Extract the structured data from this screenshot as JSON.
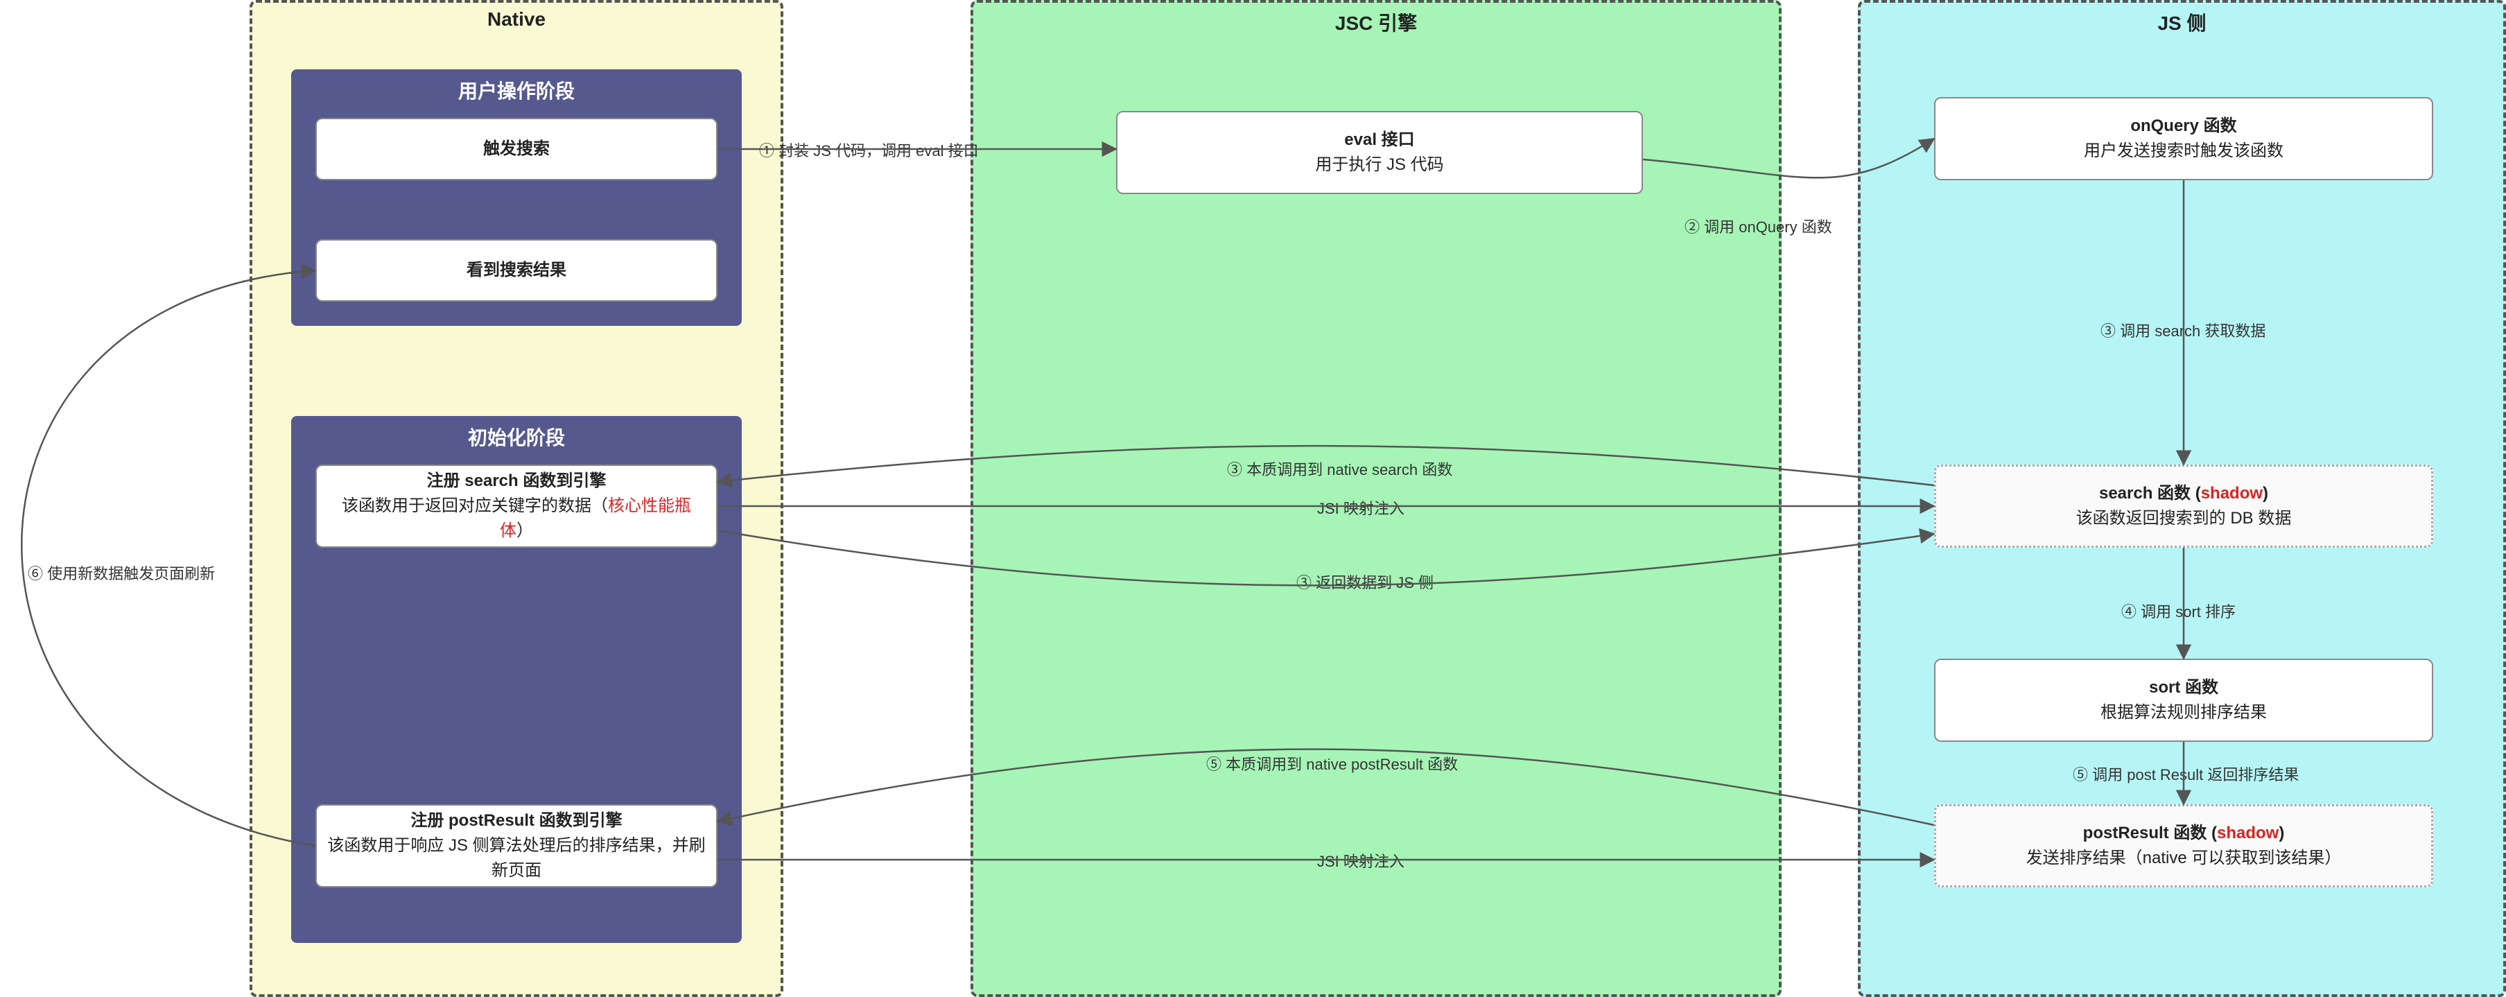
{
  "lanes": {
    "native": "Native",
    "jsc": "JSC 引擎",
    "js": "JS 侧"
  },
  "groups": {
    "user": "用户操作阶段",
    "init": "初始化阶段"
  },
  "nodes": {
    "trigger_search": {
      "t1": "触发搜索"
    },
    "see_result": {
      "t1": "看到搜索结果"
    },
    "reg_search": {
      "t1": "注册 search 函数到引擎",
      "t2a": "该函数用于返回对应关键字的数据（",
      "t2b": "核心性能瓶体",
      "t2c": "）"
    },
    "reg_post": {
      "t1": "注册 postResult 函数到引擎",
      "t2": "该函数用于响应 JS 侧算法处理后的排序结果，并刷新页面"
    },
    "eval": {
      "t1": "eval 接口",
      "t2": "用于执行 JS 代码"
    },
    "onquery": {
      "t1": "onQuery 函数",
      "t2": "用户发送搜索时触发该函数"
    },
    "search_shadow": {
      "t1a": "search 函数 (",
      "t1b": "shadow",
      "t1c": ")",
      "t2": "该函数返回搜索到的 DB 数据"
    },
    "sort": {
      "t1": "sort 函数",
      "t2": "根据算法规则排序结果"
    },
    "post_shadow": {
      "t1a": "postResult 函数 (",
      "t1b": "shadow",
      "t1c": ")",
      "t2": "发送排序结果（native 可以获取到该结果）"
    }
  },
  "edges": {
    "e1": "① 封装 JS 代码，调用 eval 接口",
    "e2": "② 调用 onQuery 函数",
    "e3": "③ 调用 search 获取数据",
    "e3a": "③ 本质调用到 native  search 函数",
    "e_jsi1": "JSI 映射注入",
    "e3b": "③ 返回数据到 JS 侧",
    "e4": "④ 调用 sort 排序",
    "e5": "⑤ 调用 post Result 返回排序结果",
    "e5a": "⑤ 本质调用到 native postResult 函数",
    "e_jsi2": "JSI 映射注入",
    "e6": "⑥ 使用新数据触发页面刷新"
  }
}
